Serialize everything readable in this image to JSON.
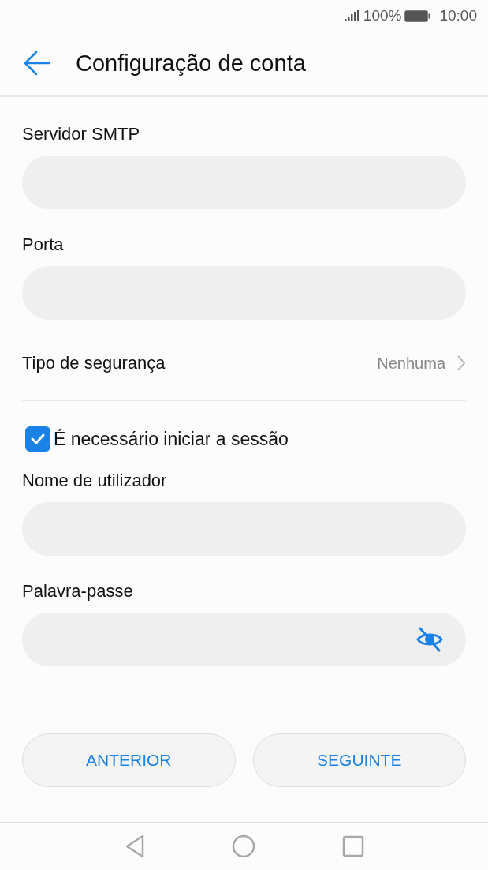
{
  "status_bar": {
    "battery": "100%",
    "time": "10:00"
  },
  "header": {
    "title": "Configuração de conta"
  },
  "form": [
    {
      "kind": "field",
      "label": "Servidor SMTP"
    },
    {
      "kind": "field",
      "label": "Porta"
    },
    {
      "kind": "select",
      "label": "Tipo de segurança",
      "value": "Nenhuma"
    },
    {
      "kind": "checkbox",
      "label": "É necessário iniciar a sessão",
      "checked": true
    },
    {
      "kind": "field",
      "label": "Nome de utilizador"
    },
    {
      "kind": "password",
      "label": "Palavra-passe"
    }
  ],
  "buttons": [
    "ANTERIOR",
    "SEGUINTE"
  ]
}
